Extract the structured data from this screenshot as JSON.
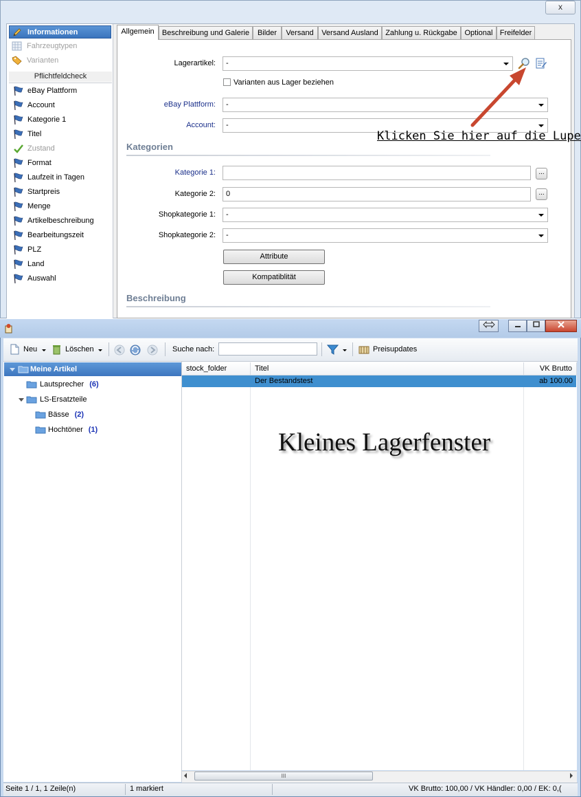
{
  "top_window": {
    "close_label": "x",
    "left_nav": {
      "items": [
        {
          "label": "Informationen",
          "state": "selected",
          "icon": "pencil-icon"
        },
        {
          "label": "Fahrzeugtypen",
          "state": "disabled",
          "icon": "grid-icon"
        },
        {
          "label": "Varianten",
          "state": "disabled",
          "icon": "tag-icon"
        }
      ],
      "check_header": "Pflichtfeldcheck",
      "check_items": [
        {
          "label": "eBay Plattform",
          "status": "flag"
        },
        {
          "label": "Account",
          "status": "flag"
        },
        {
          "label": "Kategorie 1",
          "status": "flag"
        },
        {
          "label": "Titel",
          "status": "flag"
        },
        {
          "label": "Zustand",
          "status": "ok"
        },
        {
          "label": "Format",
          "status": "flag"
        },
        {
          "label": "Laufzeit in Tagen",
          "status": "flag"
        },
        {
          "label": "Startpreis",
          "status": "flag"
        },
        {
          "label": "Menge",
          "status": "flag"
        },
        {
          "label": "Artikelbeschreibung",
          "status": "flag"
        },
        {
          "label": "Bearbeitungszeit",
          "status": "flag"
        },
        {
          "label": "PLZ",
          "status": "flag"
        },
        {
          "label": "Land",
          "status": "flag"
        },
        {
          "label": "Auswahl",
          "status": "flag"
        }
      ]
    },
    "tabs": [
      "Allgemein",
      "Beschreibung und Galerie",
      "Bilder",
      "Versand",
      "Versand Ausland",
      "Zahlung u. Rückgabe",
      "Optional",
      "Freifelder"
    ],
    "active_tab": "Allgemein",
    "form": {
      "lagerartikel_label": "Lagerartikel:",
      "lagerartikel_value": "-",
      "varianten_checkbox": "Varianten aus Lager beziehen",
      "plattform_label": "eBay Plattform:",
      "plattform_value": "-",
      "account_label": "Account:",
      "account_value": "-",
      "kategorien_title": "Kategorien",
      "kategorie1_label": "Kategorie 1:",
      "kategorie1_value": "",
      "kategorie2_label": "Kategorie 2:",
      "kategorie2_value": "0",
      "shop1_label": "Shopkategorie 1:",
      "shop1_value": "-",
      "shop2_label": "Shopkategorie 2:",
      "shop2_value": "-",
      "attribute_button": "Attribute",
      "kompat_button": "Kompatiblität",
      "beschreibung_title": "Beschreibung",
      "dots": "..."
    },
    "annotation": "Klicken Sie hier auf die Lupe"
  },
  "bottom_window": {
    "toolbar": {
      "new_label": "Neu",
      "delete_label": "Löschen",
      "search_label": "Suche nach:",
      "search_value": "",
      "price_updates_label": "Preisupdates"
    },
    "tree": {
      "root": "Meine Artikel",
      "nodes": [
        {
          "label": "Lautsprecher",
          "count": "(6)"
        },
        {
          "label": "LS-Ersatzteile",
          "count": ""
        },
        {
          "label": "Bässe",
          "count": "(2)"
        },
        {
          "label": "Hochtöner",
          "count": "(1)"
        }
      ]
    },
    "grid": {
      "columns": [
        "stock_folder",
        "Titel",
        "VK Brutto"
      ],
      "rows": [
        {
          "stock_folder": "",
          "titel": "Der Bestandstest",
          "vk_brutto": "ab 100.00"
        }
      ]
    },
    "overlay_caption": "Kleines Lagerfenster",
    "scroll_grip": "III",
    "status": {
      "page": "Seite 1 / 1, 1 Zeile(n)",
      "selected": "1 markiert",
      "prices": "VK Brutto: 100,00 / VK Händler: 0,00 / EK: 0,("
    }
  },
  "colors": {
    "selection_blue": "#3f8fcf",
    "flag_blue": "#3b6fb8",
    "ok_green": "#5aa832",
    "arrow_red": "#c8472f"
  }
}
